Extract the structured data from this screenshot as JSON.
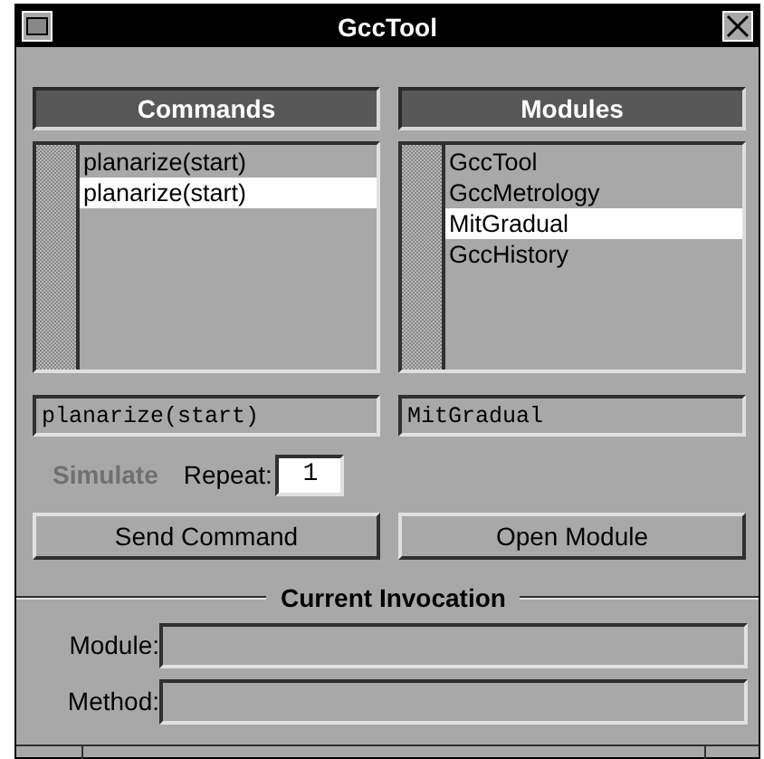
{
  "window": {
    "title": "GccTool"
  },
  "commands": {
    "header": "Commands",
    "items": [
      {
        "label": "planarize(start)",
        "selected": false
      },
      {
        "label": "planarize(start)",
        "selected": true
      }
    ],
    "entry": "planarize(start)"
  },
  "modules": {
    "header": "Modules",
    "items": [
      {
        "label": "GccTool",
        "selected": false
      },
      {
        "label": "GccMetrology",
        "selected": false
      },
      {
        "label": "MitGradual",
        "selected": true
      },
      {
        "label": "GccHistory",
        "selected": false
      }
    ],
    "entry": "MitGradual"
  },
  "simulate": {
    "label": "Simulate",
    "disabled": true
  },
  "repeat": {
    "label": "Repeat:",
    "value": "1"
  },
  "buttons": [
    "Send Command",
    "Open Module"
  ],
  "invocation": {
    "title": "Current Invocation",
    "fields": [
      {
        "label": "Module:"
      },
      {
        "label": "Method:"
      }
    ]
  }
}
